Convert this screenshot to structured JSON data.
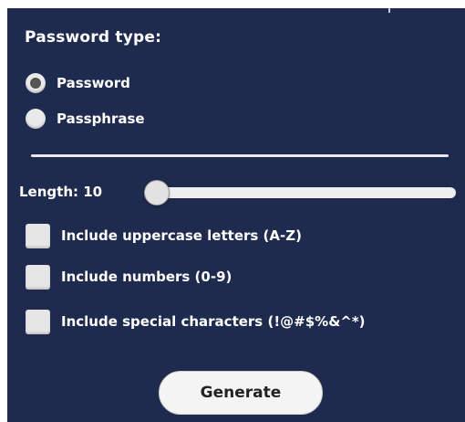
{
  "heading": "Password type:",
  "password_type": {
    "options": [
      "Password",
      "Passphrase"
    ],
    "selected": "Password"
  },
  "length": {
    "label": "Length: 10",
    "value": 10
  },
  "options": {
    "uppercase": {
      "label": "Include uppercase letters (A-Z)",
      "checked": false
    },
    "numbers": {
      "label": "Include numbers (0-9)",
      "checked": false
    },
    "special": {
      "label": "Include special characters (!@#$%&^*)",
      "checked": false
    }
  },
  "generate_label": "Generate",
  "colors": {
    "panel_background": "#1e2a4e",
    "text": "#ffffff",
    "control": "#eaeaea"
  }
}
